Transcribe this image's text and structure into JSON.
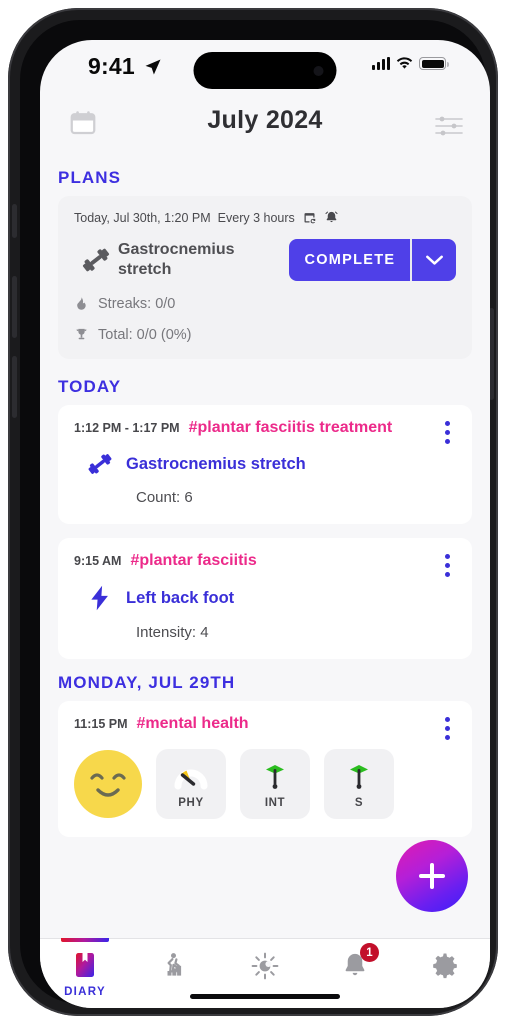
{
  "status_bar": {
    "time": "9:41",
    "location_icon": "location-arrow-icon",
    "signal_icon": "cellular-signal-icon",
    "wifi_icon": "wifi-icon",
    "battery_icon": "battery-full-icon"
  },
  "header": {
    "calendar_icon": "calendar-icon",
    "title": "July 2024",
    "filter_icon": "sliders-filter-icon"
  },
  "sections": {
    "plans_label": "PLANS",
    "today_label": "TODAY",
    "monday_label": "MONDAY, JUL 29TH"
  },
  "plan_card": {
    "schedule": "Today, Jul 30th, 1:20 PM",
    "repeat": "Every 3 hours",
    "repeat_icon": "calendar-repeat-icon",
    "alarm_icon": "alarm-bell-icon",
    "activity_icon": "dumbbell-icon",
    "activity_name": "Gastrocnemius stretch",
    "complete_label": "COMPLETE",
    "caret_icon": "chevron-down-icon",
    "streaks_icon": "flame-icon",
    "streaks_text": "Streaks: 0/0",
    "total_icon": "trophy-icon",
    "total_text": "Total: 0/0 (0%)"
  },
  "entries": [
    {
      "time": "1:12 PM - 1:17 PM",
      "tag": "#plantar fasciitis treatment",
      "icon": "dumbbell-icon",
      "title": "Gastrocnemius stretch",
      "detail": "Count: 6",
      "menu_icon": "kebab-menu-icon"
    },
    {
      "time": "9:15 AM",
      "tag": "#plantar fasciitis",
      "icon": "lightning-bolt-icon",
      "title": "Left back foot",
      "detail": "Intensity: 4",
      "menu_icon": "kebab-menu-icon"
    }
  ],
  "mood_entry": {
    "time": "11:15 PM",
    "tag": "#mental health",
    "menu_icon": "kebab-menu-icon",
    "emoji_icon": "smiling-face-icon",
    "tiles": [
      {
        "icon": "gauge-yellow-icon",
        "label": "PHY"
      },
      {
        "icon": "dart-green-icon",
        "label": "INT"
      },
      {
        "icon": "dart-green-icon",
        "label": "S"
      }
    ]
  },
  "fab": {
    "icon": "plus-icon",
    "label": "Add entry"
  },
  "tabbar": [
    {
      "icon": "diary-book-icon",
      "label": "DIARY",
      "active": true,
      "badge": ""
    },
    {
      "icon": "activity-stats-icon",
      "label": "",
      "active": false,
      "badge": ""
    },
    {
      "icon": "sun-weather-icon",
      "label": "",
      "active": false,
      "badge": ""
    },
    {
      "icon": "bell-notifications-icon",
      "label": "",
      "active": false,
      "badge": "1"
    },
    {
      "icon": "gear-settings-icon",
      "label": "",
      "active": false,
      "badge": ""
    }
  ],
  "colors": {
    "accent_blue": "#3a2fd8",
    "button_blue": "#4f40e8",
    "tag_pink": "#ec2a8a",
    "badge_red": "#c20f2a",
    "emoji_yellow": "#f7d84b"
  }
}
